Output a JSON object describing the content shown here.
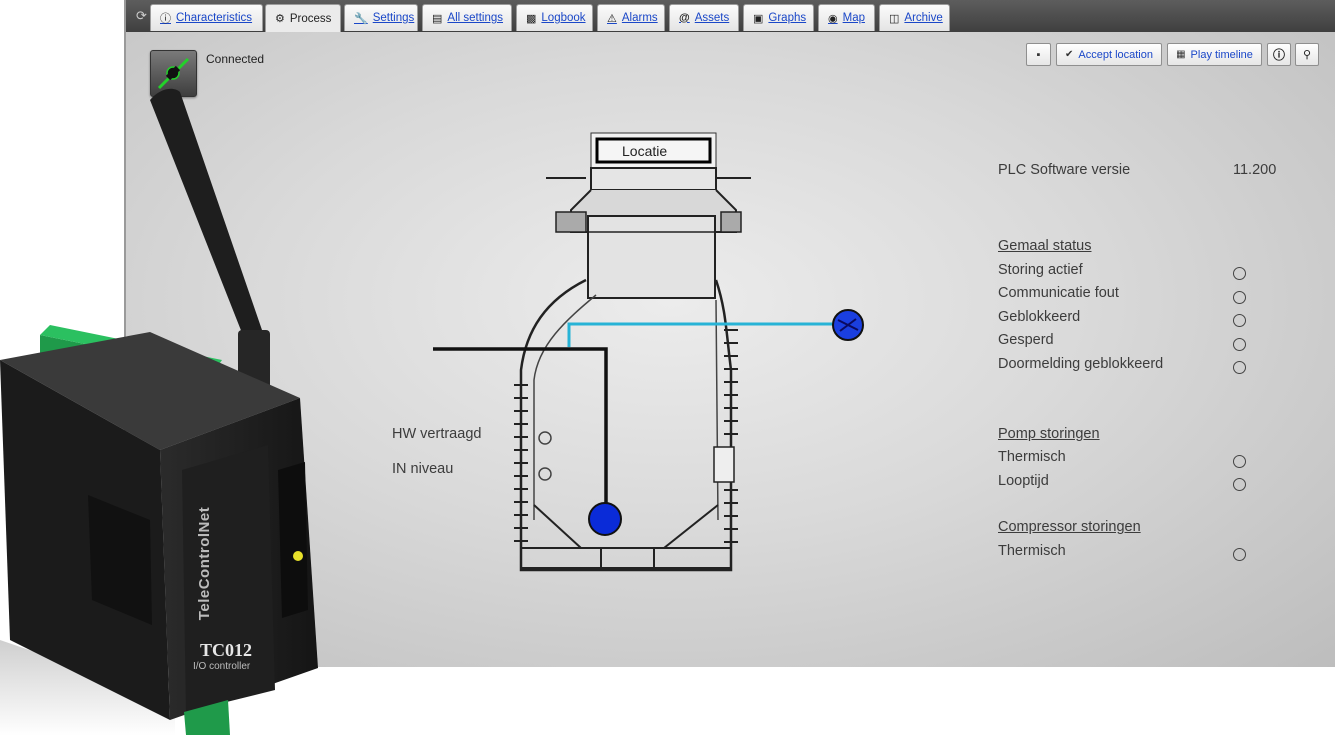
{
  "tabs": [
    {
      "label": "Characteristics",
      "icon": "info-icon"
    },
    {
      "label": "Process",
      "icon": "gear-icon",
      "active": true
    },
    {
      "label": "Settings",
      "icon": "wrench-icon"
    },
    {
      "label": "All settings",
      "icon": "settings-list-icon"
    },
    {
      "label": "Logbook",
      "icon": "book-icon"
    },
    {
      "label": "Alarms",
      "icon": "warning-icon"
    },
    {
      "label": "Assets",
      "icon": "at-icon"
    },
    {
      "label": "Graphs",
      "icon": "image-icon"
    },
    {
      "label": "Map",
      "icon": "globe-icon"
    },
    {
      "label": "Archive",
      "icon": "folder-icon"
    }
  ],
  "status": {
    "connection": "Connected"
  },
  "toolbar": {
    "accept_location": "Accept location",
    "play_timeline": "Play timeline"
  },
  "diagram": {
    "location_label": "Locatie",
    "hw_vertraagd": "HW vertraagd",
    "in_niveau": "IN niveau"
  },
  "panel": {
    "plc_label": "PLC Software versie",
    "plc_value": "11.200",
    "gemaal_header": "Gemaal status",
    "gemaal_items": [
      "Storing actief",
      "Communicatie fout",
      "Geblokkeerd",
      "Gesperd",
      "Doormelding geblokkeerd"
    ],
    "pomp_header": "Pomp storingen",
    "pomp_items": [
      "Thermisch",
      "Looptijd"
    ],
    "compressor_header": "Compressor storingen",
    "compressor_items": [
      "Thermisch"
    ]
  },
  "device": {
    "brand": "TeleControlNet",
    "model": "TC012",
    "subtitle": "I/O controller"
  },
  "colors": {
    "accent_link": "#1a47c8",
    "float_blue": "#0a2bd8",
    "pipe_cyan": "#27b3d6"
  }
}
